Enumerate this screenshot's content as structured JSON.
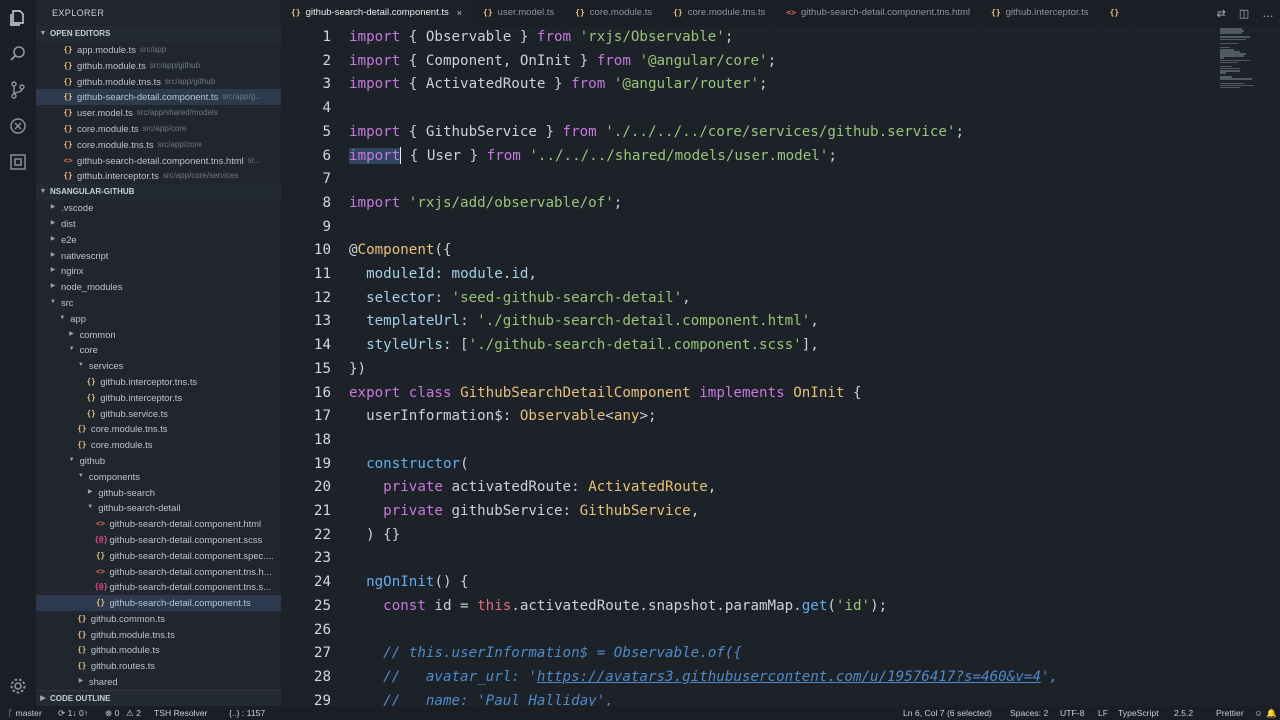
{
  "sidebar": {
    "title": "EXPLORER",
    "open_editors_label": "OPEN EDITORS",
    "open_editors": [
      {
        "name": "app.module.ts",
        "path": "src/app",
        "type": "ts"
      },
      {
        "name": "github.module.ts",
        "path": "src/app/github",
        "type": "ts"
      },
      {
        "name": "github.module.tns.ts",
        "path": "src/app/github",
        "type": "ts"
      },
      {
        "name": "github-search-detail.component.ts",
        "path": "src/app/g...",
        "type": "ts",
        "selected": true
      },
      {
        "name": "user.model.ts",
        "path": "src/app/shared/models",
        "type": "ts"
      },
      {
        "name": "core.module.ts",
        "path": "src/app/core",
        "type": "ts"
      },
      {
        "name": "core.module.tns.ts",
        "path": "src/app/core",
        "type": "ts"
      },
      {
        "name": "github-search-detail.component.tns.html",
        "path": "sr...",
        "type": "html"
      },
      {
        "name": "github.interceptor.ts",
        "path": "src/app/core/services",
        "type": "ts"
      }
    ],
    "project_label": "NSANGULAR-GITHUB",
    "tree": [
      {
        "name": ".vscode",
        "depth": 0,
        "kind": "folder",
        "open": false
      },
      {
        "name": "dist",
        "depth": 0,
        "kind": "folder",
        "open": false
      },
      {
        "name": "e2e",
        "depth": 0,
        "kind": "folder",
        "open": false
      },
      {
        "name": "nativescript",
        "depth": 0,
        "kind": "folder",
        "open": false
      },
      {
        "name": "nginx",
        "depth": 0,
        "kind": "folder",
        "open": false
      },
      {
        "name": "node_modules",
        "depth": 0,
        "kind": "folder",
        "open": false
      },
      {
        "name": "src",
        "depth": 0,
        "kind": "folder",
        "open": true
      },
      {
        "name": "app",
        "depth": 1,
        "kind": "folder",
        "open": true
      },
      {
        "name": "common",
        "depth": 2,
        "kind": "folder",
        "open": false
      },
      {
        "name": "core",
        "depth": 2,
        "kind": "folder",
        "open": true
      },
      {
        "name": "services",
        "depth": 3,
        "kind": "folder",
        "open": true
      },
      {
        "name": "github.interceptor.tns.ts",
        "depth": 4,
        "kind": "ts"
      },
      {
        "name": "github.interceptor.ts",
        "depth": 4,
        "kind": "ts"
      },
      {
        "name": "github.service.ts",
        "depth": 4,
        "kind": "ts"
      },
      {
        "name": "core.module.tns.ts",
        "depth": 3,
        "kind": "ts"
      },
      {
        "name": "core.module.ts",
        "depth": 3,
        "kind": "ts"
      },
      {
        "name": "github",
        "depth": 2,
        "kind": "folder",
        "open": true
      },
      {
        "name": "components",
        "depth": 3,
        "kind": "folder",
        "open": true
      },
      {
        "name": "github-search",
        "depth": 4,
        "kind": "folder",
        "open": false
      },
      {
        "name": "github-search-detail",
        "depth": 4,
        "kind": "folder",
        "open": true
      },
      {
        "name": "github-search-detail.component.html",
        "depth": 5,
        "kind": "html"
      },
      {
        "name": "github-search-detail.component.scss",
        "depth": 5,
        "kind": "scss"
      },
      {
        "name": "github-search-detail.component.spec....",
        "depth": 5,
        "kind": "ts"
      },
      {
        "name": "github-search-detail.component.tns.h...",
        "depth": 5,
        "kind": "html"
      },
      {
        "name": "github-search-detail.component.tns.s...",
        "depth": 5,
        "kind": "scss"
      },
      {
        "name": "github-search-detail.component.ts",
        "depth": 5,
        "kind": "ts",
        "selected": true
      },
      {
        "name": "github.common.ts",
        "depth": 3,
        "kind": "ts"
      },
      {
        "name": "github.module.tns.ts",
        "depth": 3,
        "kind": "ts"
      },
      {
        "name": "github.module.ts",
        "depth": 3,
        "kind": "ts"
      },
      {
        "name": "github.routes.ts",
        "depth": 3,
        "kind": "ts"
      },
      {
        "name": "shared",
        "depth": 3,
        "kind": "folder",
        "open": false
      }
    ],
    "outline_label": "CODE OUTLINE"
  },
  "tabs": [
    {
      "name": "github-search-detail.component.ts",
      "type": "ts",
      "active": true
    },
    {
      "name": "user.model.ts",
      "type": "ts"
    },
    {
      "name": "core.module.ts",
      "type": "ts"
    },
    {
      "name": "core.module.tns.ts",
      "type": "ts"
    },
    {
      "name": "github-search-detail.component.tns.html",
      "type": "html"
    },
    {
      "name": "github.interceptor.ts",
      "type": "ts"
    },
    {
      "name": "",
      "type": "ts"
    }
  ],
  "icons": {
    "ts": "{}",
    "html": "<>",
    "scss": "{@}",
    "close": "×",
    "chevron_open": "▼",
    "chevron_closed": "▶"
  },
  "code_lines": [
    [
      [
        "kw",
        "import"
      ],
      [
        "plain",
        " { Observable } "
      ],
      [
        "kw",
        "from"
      ],
      [
        "plain",
        " "
      ],
      [
        "str",
        "'rxjs/Observable'"
      ],
      [
        "plain",
        ";"
      ]
    ],
    [
      [
        "kw",
        "import"
      ],
      [
        "plain",
        " { Component, OnInit } "
      ],
      [
        "kw",
        "from"
      ],
      [
        "plain",
        " "
      ],
      [
        "str",
        "'@angular/core'"
      ],
      [
        "plain",
        ";"
      ]
    ],
    [
      [
        "kw",
        "import"
      ],
      [
        "plain",
        " { ActivatedRoute } "
      ],
      [
        "kw",
        "from"
      ],
      [
        "plain",
        " "
      ],
      [
        "str",
        "'@angular/router'"
      ],
      [
        "plain",
        ";"
      ]
    ],
    [],
    [
      [
        "kw",
        "import"
      ],
      [
        "plain",
        " { GithubService } "
      ],
      [
        "kw",
        "from"
      ],
      [
        "plain",
        " "
      ],
      [
        "str",
        "'./../../../core/services/github.service'"
      ],
      [
        "plain",
        ";"
      ]
    ],
    [
      [
        "sel",
        "import"
      ],
      [
        "cursor",
        ""
      ],
      [
        "plain",
        " { User } "
      ],
      [
        "kw",
        "from"
      ],
      [
        "plain",
        " "
      ],
      [
        "str",
        "'../../../shared/models/user.model'"
      ],
      [
        "plain",
        ";"
      ]
    ],
    [],
    [
      [
        "kw",
        "import"
      ],
      [
        "plain",
        " "
      ],
      [
        "str",
        "'rxjs/add/observable/of'"
      ],
      [
        "plain",
        ";"
      ]
    ],
    [],
    [
      [
        "plain",
        "@"
      ],
      [
        "cls",
        "Component"
      ],
      [
        "plain",
        "({"
      ]
    ],
    [
      [
        "plain",
        "  "
      ],
      [
        "prop",
        "moduleId"
      ],
      [
        "plain",
        ": "
      ],
      [
        "prop",
        "module"
      ],
      [
        "plain",
        "."
      ],
      [
        "prop",
        "id"
      ],
      [
        "plain",
        ","
      ]
    ],
    [
      [
        "plain",
        "  "
      ],
      [
        "prop",
        "selector"
      ],
      [
        "plain",
        ": "
      ],
      [
        "str",
        "'seed-github-search-detail'"
      ],
      [
        "plain",
        ","
      ]
    ],
    [
      [
        "plain",
        "  "
      ],
      [
        "prop",
        "templateUrl"
      ],
      [
        "plain",
        ": "
      ],
      [
        "str",
        "'./github-search-detail.component.html'"
      ],
      [
        "plain",
        ","
      ]
    ],
    [
      [
        "plain",
        "  "
      ],
      [
        "prop",
        "styleUrls"
      ],
      [
        "plain",
        ": ["
      ],
      [
        "str",
        "'./github-search-detail.component.scss'"
      ],
      [
        "plain",
        "],"
      ]
    ],
    [
      [
        "plain",
        "})"
      ]
    ],
    [
      [
        "kw",
        "export"
      ],
      [
        "plain",
        " "
      ],
      [
        "kw",
        "class"
      ],
      [
        "plain",
        " "
      ],
      [
        "cls",
        "GithubSearchDetailComponent"
      ],
      [
        "plain",
        " "
      ],
      [
        "kw",
        "implements"
      ],
      [
        "plain",
        " "
      ],
      [
        "cls",
        "OnInit"
      ],
      [
        "plain",
        " {"
      ]
    ],
    [
      [
        "plain",
        "  userInformation$: "
      ],
      [
        "cls",
        "Observable"
      ],
      [
        "plain",
        "<"
      ],
      [
        "cls",
        "any"
      ],
      [
        "plain",
        ">;"
      ]
    ],
    [],
    [
      [
        "plain",
        "  "
      ],
      [
        "fn",
        "constructor"
      ],
      [
        "plain",
        "("
      ]
    ],
    [
      [
        "plain",
        "    "
      ],
      [
        "kw",
        "private"
      ],
      [
        "plain",
        " activatedRoute: "
      ],
      [
        "cls",
        "ActivatedRoute"
      ],
      [
        "plain",
        ","
      ]
    ],
    [
      [
        "plain",
        "    "
      ],
      [
        "kw",
        "private"
      ],
      [
        "plain",
        " githubService: "
      ],
      [
        "cls",
        "GithubService"
      ],
      [
        "plain",
        ","
      ]
    ],
    [
      [
        "plain",
        "  ) {}"
      ]
    ],
    [],
    [
      [
        "plain",
        "  "
      ],
      [
        "fn",
        "ngOnInit"
      ],
      [
        "plain",
        "() {"
      ]
    ],
    [
      [
        "plain",
        "    "
      ],
      [
        "kw",
        "const"
      ],
      [
        "plain",
        " id = "
      ],
      [
        "thiskw",
        "this"
      ],
      [
        "plain",
        ".activatedRoute.snapshot.paramMap."
      ],
      [
        "fn",
        "get"
      ],
      [
        "plain",
        "("
      ],
      [
        "str",
        "'id'"
      ],
      [
        "plain",
        ");"
      ]
    ],
    [],
    [
      [
        "plain",
        "    "
      ],
      [
        "cm",
        "// this.userInformation$ = Observable.of({"
      ]
    ],
    [
      [
        "plain",
        "    "
      ],
      [
        "cm",
        "//   avatar_url: '"
      ],
      [
        "cmurl",
        "https://avatars3.githubusercontent.com/u/19576417?s=460&v=4"
      ],
      [
        "cm",
        "',"
      ]
    ],
    [
      [
        "plain",
        "    "
      ],
      [
        "cm",
        "//   name: 'Paul Halliday',"
      ]
    ]
  ],
  "status": {
    "branch": "master",
    "sync": "1↓ 0↑",
    "errors": "⊗ 0",
    "warnings": "⚠ 2",
    "resolver": "TSH Resolver",
    "braces": "{..} : 1157",
    "position": "Ln 6, Col 7 (6 selected)",
    "spaces": "Spaces: 2",
    "encoding": "UTF-8",
    "eol": "LF",
    "language": "TypeScript",
    "version": "2.5.2",
    "formatter": "Prettier",
    "emoji": "☺",
    "bell": "🔔"
  }
}
